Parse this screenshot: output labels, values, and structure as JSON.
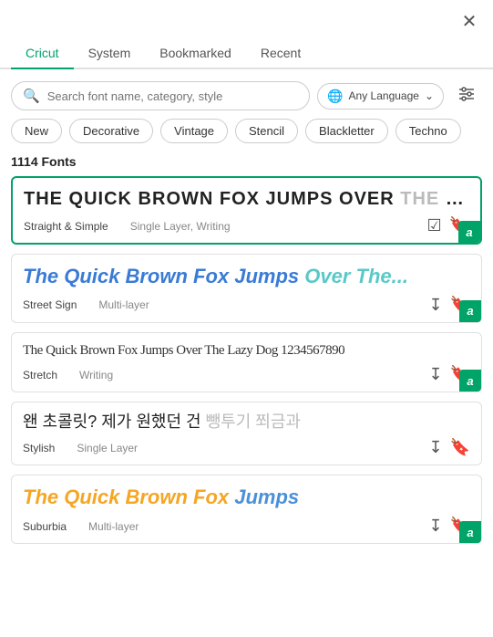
{
  "tabs": [
    {
      "id": "cricut",
      "label": "Cricut",
      "active": true
    },
    {
      "id": "system",
      "label": "System",
      "active": false
    },
    {
      "id": "bookmarked",
      "label": "Bookmarked",
      "active": false
    },
    {
      "id": "recent",
      "label": "Recent",
      "active": false
    }
  ],
  "search": {
    "placeholder": "Search font name, category, style"
  },
  "language": {
    "label": "Any Language"
  },
  "chips": [
    {
      "id": "new",
      "label": "New",
      "active": false
    },
    {
      "id": "decorative",
      "label": "Decorative",
      "active": false
    },
    {
      "id": "vintage",
      "label": "Vintage",
      "active": false
    },
    {
      "id": "stencil",
      "label": "Stencil",
      "active": false
    },
    {
      "id": "blackletter",
      "label": "Blackletter",
      "active": false
    },
    {
      "id": "techno",
      "label": "Techno",
      "active": false
    }
  ],
  "font_count": "1114 Fonts",
  "fonts": [
    {
      "id": 1,
      "preview_text": "THE QUICK BROWN FOX JUMPS OVER THE LAZY DOG",
      "name": "Straight & Simple",
      "type": "Single Layer, Writing",
      "selected": true,
      "has_badge": true
    },
    {
      "id": 2,
      "preview_text": "The Quick Brown Fox Jumps Over The...",
      "name": "Street Sign",
      "type": "Multi-layer",
      "selected": false,
      "has_badge": true
    },
    {
      "id": 3,
      "preview_text": "The Quick Brown Fox Jumps Over The Lazy Dog 1234567890",
      "name": "Stretch",
      "type": "Writing",
      "selected": false,
      "has_badge": true
    },
    {
      "id": 4,
      "preview_text": "왠 초콜릿? 제가 원했던 건 뺑투기 쬐금과",
      "name": "Stylish",
      "type": "Single Layer",
      "selected": false,
      "has_badge": false
    },
    {
      "id": 5,
      "preview_text": "The Quick Brown Fox Jumps",
      "name": "Suburbia",
      "type": "Multi-layer",
      "selected": false,
      "has_badge": true
    }
  ],
  "icons": {
    "close": "✕",
    "search": "🔍",
    "globe": "🌐",
    "chevron_down": "⌄",
    "filter": "⊟",
    "download": "⬇",
    "bookmark": "🔖",
    "badge_a": "a"
  }
}
